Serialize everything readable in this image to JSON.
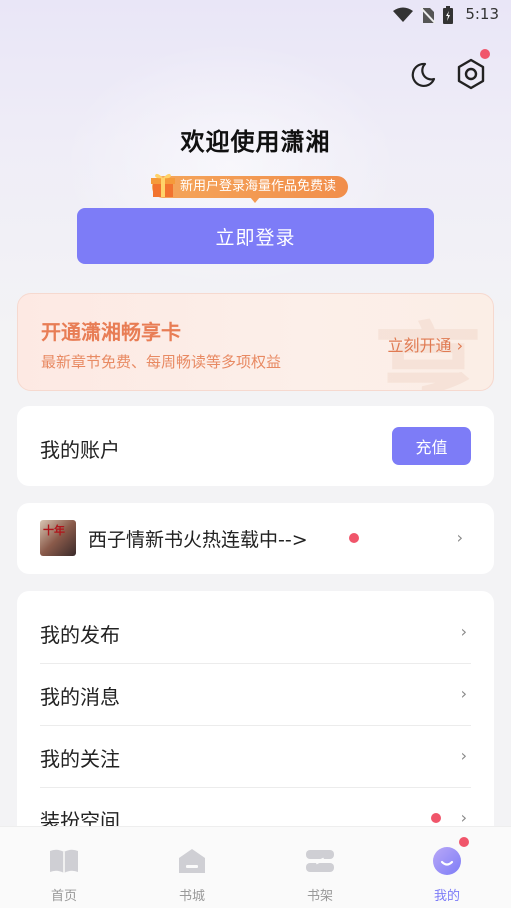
{
  "status_bar": {
    "time": "5:13"
  },
  "header": {
    "welcome_title": "欢迎使用潇湘",
    "promo_text": "新用户登录海量作品免费读",
    "login_button": "立即登录"
  },
  "vip_card": {
    "title": "开通潇湘畅享卡",
    "subtitle": "最新章节免费、每周畅读等多项权益",
    "action": "立刻开通 ›",
    "watermark": "享"
  },
  "account": {
    "label": "我的账户",
    "recharge_button": "充值"
  },
  "book_promo": {
    "text": "西子情新书火热连载中-->",
    "thumb_text": "十年"
  },
  "menu": {
    "items": [
      {
        "label": "我的发布"
      },
      {
        "label": "我的消息"
      },
      {
        "label": "我的关注"
      },
      {
        "label": "装扮空间"
      }
    ]
  },
  "tabbar": {
    "tabs": [
      {
        "label": "首页"
      },
      {
        "label": "书城"
      },
      {
        "label": "书架"
      },
      {
        "label": "我的"
      }
    ],
    "active_index": 3
  },
  "colors": {
    "accent": "#7d7cf7",
    "vip_orange": "#e87d55",
    "badge_red": "#f0556a"
  }
}
